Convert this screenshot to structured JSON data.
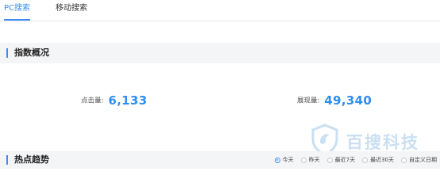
{
  "tabs": [
    {
      "label": "PC搜索",
      "active": true
    },
    {
      "label": "移动搜索",
      "active": false
    }
  ],
  "overview": {
    "title": "指数概况",
    "clicks_label": "点击量:",
    "clicks_value": "6,133",
    "impressions_label": "展现量:",
    "impressions_value": "49,340"
  },
  "trend": {
    "title": "热点趋势",
    "range_options": [
      {
        "label": "今天",
        "checked": true
      },
      {
        "label": "昨天",
        "checked": false
      },
      {
        "label": "最近7天",
        "checked": false
      },
      {
        "label": "最近30天",
        "checked": false
      },
      {
        "label": "自定义日期",
        "checked": false
      }
    ]
  },
  "watermark": {
    "text": "百搜科技",
    "icon": "shield-logo-icon"
  },
  "colors": {
    "accent": "#3b8cf7",
    "value": "#2f8ef0",
    "section_bg": "#f4f5f7"
  }
}
